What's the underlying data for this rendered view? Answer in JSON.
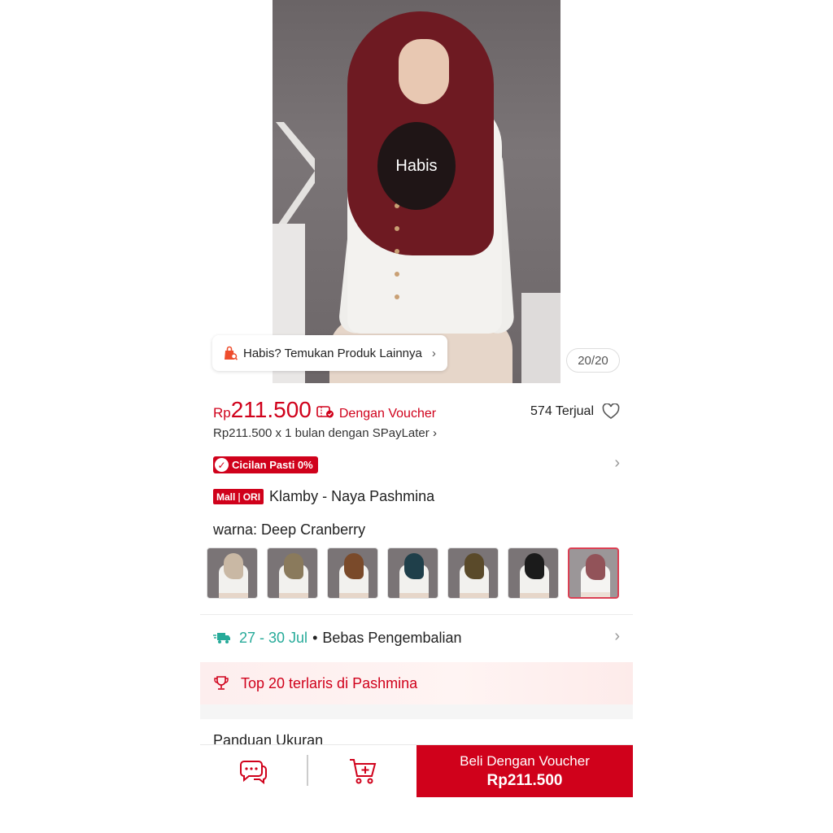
{
  "hero": {
    "sold_out_label": "Habis",
    "find_other_label": "Habis? Temukan Produk Lainnya",
    "image_counter": "20/20"
  },
  "price": {
    "currency": "Rp",
    "value": "211.500",
    "voucher_label": "Dengan Voucher",
    "sold_count": "574 Terjual",
    "paylater": "Rp211.500 x 1 bulan dengan SPayLater"
  },
  "badges": {
    "cicilan": "Cicilan Pasti 0%",
    "mall": "Mall",
    "ori": "ORI"
  },
  "product": {
    "title": "Klamby - Naya Pashmina"
  },
  "variant": {
    "label": "warna:",
    "selected": "Deep Cranberry",
    "swatches": [
      "#c9b8a4",
      "#8a7a5c",
      "#7a4a2a",
      "#1f3f4a",
      "#5a4a2a",
      "#1b1b1b",
      "#6e1a22"
    ]
  },
  "shipping": {
    "date": "27 - 30 Jul",
    "separator": "•",
    "returns": "Bebas Pengembalian"
  },
  "ranking": {
    "label": "Top 20 terlaris di Pashmina"
  },
  "size_guide": {
    "label": "Panduan Ukuran"
  },
  "bottom_bar": {
    "buy_label": "Beli Dengan Voucher",
    "buy_price": "Rp211.500"
  },
  "colors": {
    "accent": "#d0011b",
    "shipping": "#26aa99"
  }
}
